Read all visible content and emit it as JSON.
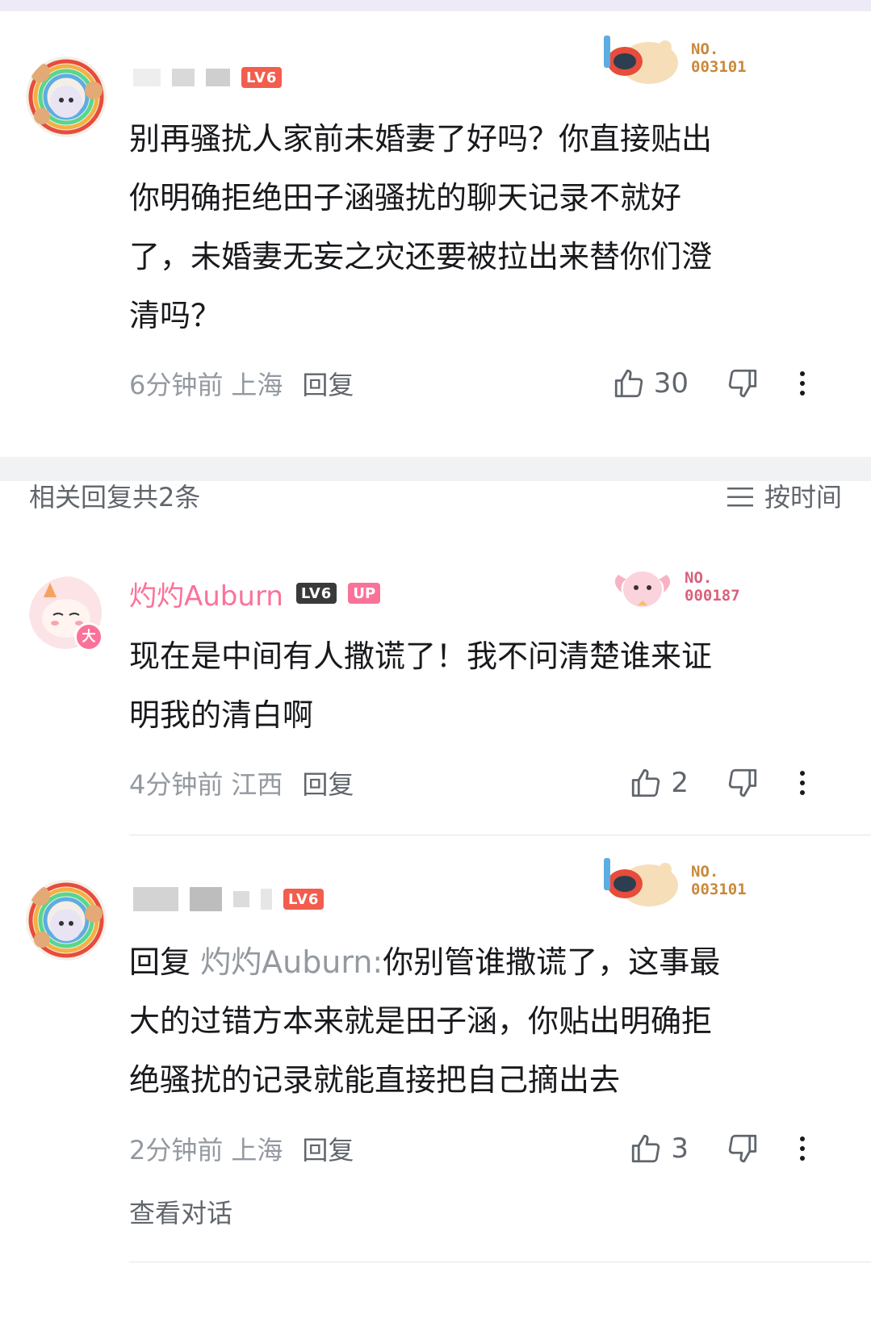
{
  "comment_main": {
    "user_level": "LV6",
    "fan_medal_no_label": "NO.",
    "fan_medal_no": "003101",
    "text": "别再骚扰人家前未婚妻了好吗？你直接贴出你明确拒绝田子涵骚扰的聊天记录不就好了，未婚妻无妄之灾还要被拉出来替你们澄清吗？",
    "lines": [
      "别再骚扰人家前未婚妻了好吗？你直接贴出",
      "你明确拒绝田子涵骚扰的聊天记录不就好",
      "了，未婚妻无妄之灾还要被拉出来替你们澄",
      "清吗？"
    ],
    "time": "6分钟前",
    "location": "上海",
    "reply_label": "回复",
    "likes": "30"
  },
  "section": {
    "title": "相关回复共2条",
    "sort_label": "按时间"
  },
  "reply_1": {
    "username": "灼灼Auburn",
    "user_level": "LV6",
    "up_tag": "UP",
    "avatar_badge": "大",
    "fan_medal_no_label": "NO.",
    "fan_medal_no": "000187",
    "lines": [
      "现在是中间有人撒谎了！我不问清楚谁来证",
      "明我的清白啊"
    ],
    "time": "4分钟前",
    "location": "江西",
    "reply_label": "回复",
    "likes": "2"
  },
  "reply_2": {
    "user_level": "LV6",
    "fan_medal_no_label": "NO.",
    "fan_medal_no": "003101",
    "reply_prefix": "回复",
    "reply_target": "灼灼Auburn:",
    "line1_rest": "你别管谁撒谎了，这事最",
    "lines": [
      "大的过错方本来就是田子涵，你贴出明确拒",
      "绝骚扰的记录就能直接把自己摘出去"
    ],
    "time": "2分钟前",
    "location": "上海",
    "reply_label": "回复",
    "likes": "3",
    "view_conversation": "查看对话"
  },
  "colors": {
    "accent_pink": "#fb7299",
    "level_red": "#f25d4e",
    "text_primary": "#18191c",
    "text_secondary": "#9499a0",
    "medal_gold": "#c9893a",
    "medal_pink": "#d9617b"
  },
  "icons": [
    "thumb-up-icon",
    "thumb-down-icon",
    "more-vertical-icon",
    "sort-lines-icon"
  ]
}
